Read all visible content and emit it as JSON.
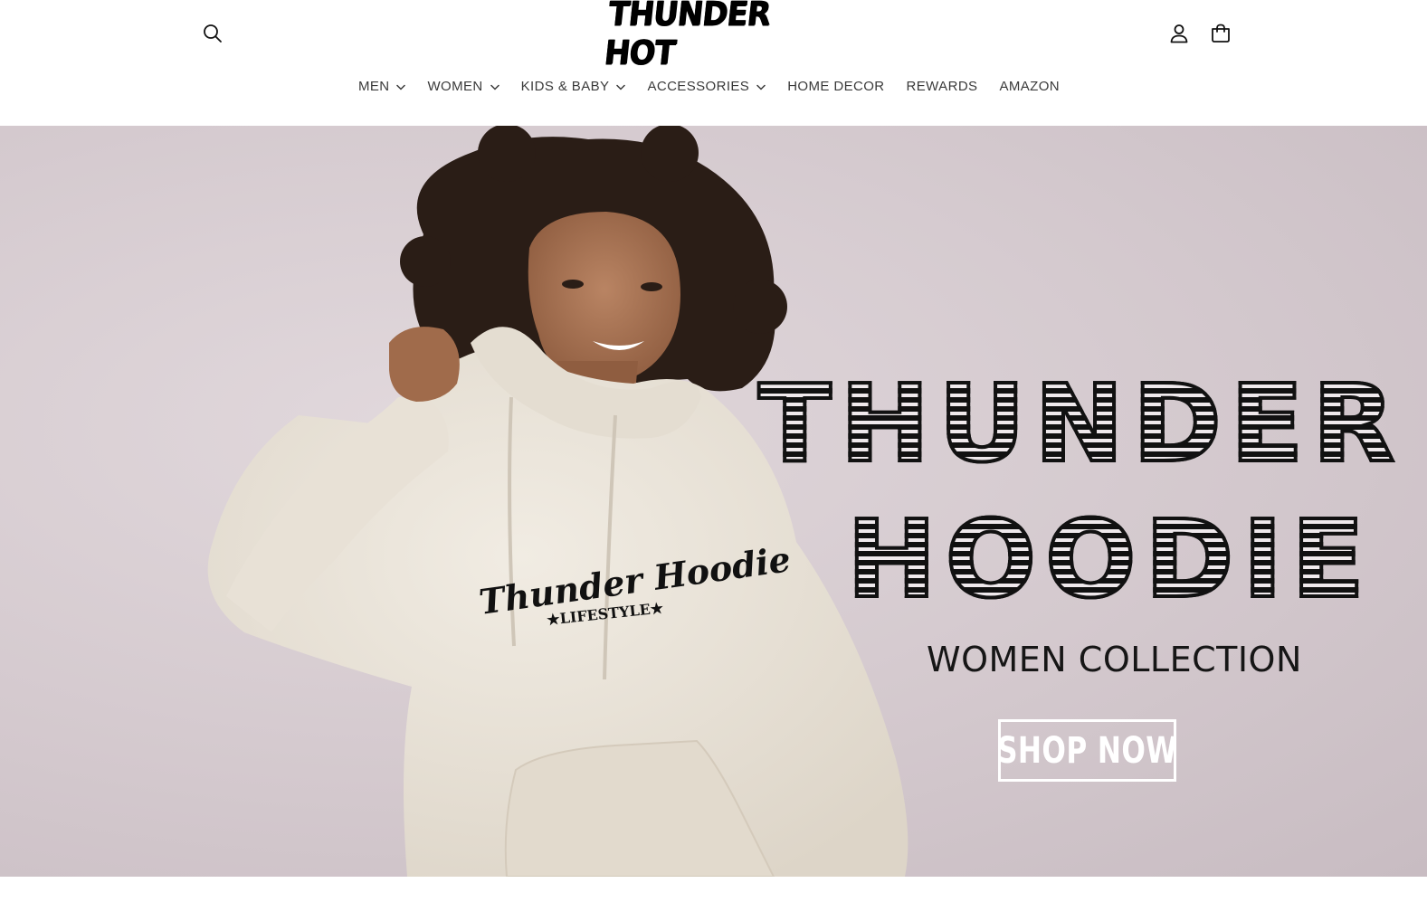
{
  "header": {
    "logo_text": "THUNDER HOT",
    "icons": {
      "search": "search-icon",
      "account": "user-icon",
      "cart": "cart-icon"
    }
  },
  "nav": {
    "items": [
      {
        "label": "MEN",
        "has_dropdown": true
      },
      {
        "label": "WOMEN",
        "has_dropdown": true
      },
      {
        "label": "KIDS & BABY",
        "has_dropdown": true
      },
      {
        "label": "ACCESSORIES",
        "has_dropdown": true
      },
      {
        "label": "HOME DECOR",
        "has_dropdown": false
      },
      {
        "label": "REWARDS",
        "has_dropdown": false
      },
      {
        "label": "AMAZON",
        "has_dropdown": false
      }
    ]
  },
  "hero": {
    "headline_line1": "THUNDER",
    "headline_line2": "HOODIE",
    "subtitle": "WOMEN COLLECTION",
    "cta_label": "SHOP NOW",
    "chest_print_script": "Thunder Hoodie",
    "chest_print_sub": "★LIFESTYLE★",
    "colors": {
      "background": "#d4c9ce",
      "hoodie": "#ece7de",
      "headline": "#111111",
      "cta_border": "#ffffff"
    }
  }
}
